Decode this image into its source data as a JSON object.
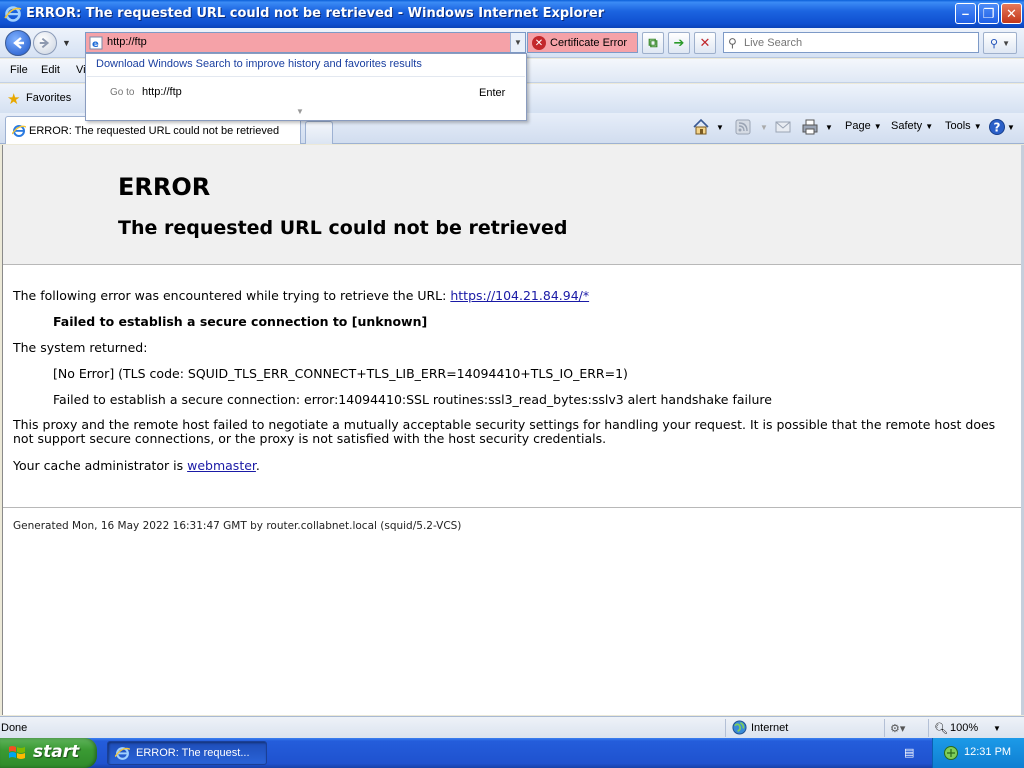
{
  "window": {
    "title": "ERROR: The requested URL could not be retrieved - Windows Internet Explorer",
    "minimize_glyph": "–",
    "maximize_glyph": "❐",
    "close_glyph": "✕"
  },
  "address": {
    "url": "http://ftp",
    "certificate_error": "Certificate Error",
    "search_placeholder": "Live Search"
  },
  "autocomplete": {
    "tip": "Download Windows Search to improve history and favorites results",
    "goto_label": "Go to",
    "goto_url": "http://ftp",
    "enter_label": "Enter"
  },
  "menu": {
    "file": "File",
    "edit": "Edit",
    "view": "Vi"
  },
  "favorites": {
    "label": "Favorites"
  },
  "tab": {
    "label": "ERROR: The requested URL could not be retrieved"
  },
  "commandbar": {
    "page": "Page",
    "safety": "Safety",
    "tools": "Tools"
  },
  "page": {
    "h1": "ERROR",
    "h2": "The requested URL could not be retrieved",
    "intro": "The following error was encountered while trying to retrieve the URL: ",
    "url_link": "https://104.21.84.94/*",
    "failed_bold": "Failed to establish a secure connection to [unknown]",
    "system_returned": "The system returned:",
    "no_error": "[No Error] (TLS code: SQUID_TLS_ERR_CONNECT+TLS_LIB_ERR=14094410+TLS_IO_ERR=1)",
    "failed_detail": "Failed to establish a secure connection: error:14094410:SSL routines:ssl3_read_bytes:sslv3 alert handshake failure",
    "explanation": "This proxy and the remote host failed to negotiate a mutually acceptable security settings for handling your request. It is possible that the remote host does not support secure connections, or the proxy is not satisfied with the host security credentials.",
    "admin_prefix": "Your cache administrator is ",
    "admin_link": "webmaster",
    "admin_suffix": ".",
    "generated": "Generated Mon, 16 May 2022 16:31:47 GMT by router.collabnet.local (squid/5.2-VCS)"
  },
  "status": {
    "left": "Done",
    "zone": "Internet",
    "zoom": "100%"
  },
  "taskbar": {
    "start": "start",
    "item": "ERROR: The request...",
    "clock": "12:31 PM"
  },
  "colors": {
    "address_error_bg": "#f5a2a8",
    "link": "#1a1aa6",
    "titlebar": "#1b64e0",
    "start_green": "#3a9a33"
  }
}
